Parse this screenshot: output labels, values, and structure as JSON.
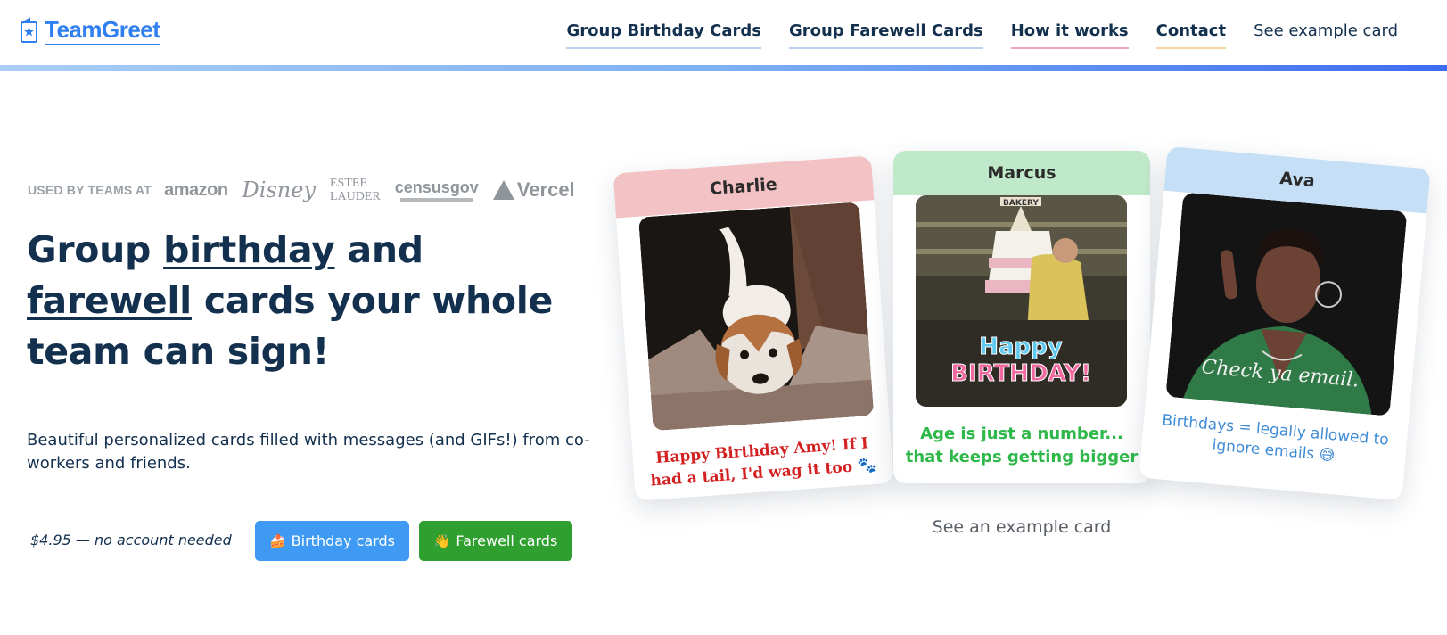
{
  "header": {
    "logo_text": "TeamGreet",
    "nav": [
      {
        "label": "Group Birthday Cards"
      },
      {
        "label": "Group Farewell Cards"
      },
      {
        "label": "How it works"
      },
      {
        "label": "Contact"
      },
      {
        "label": "See example card"
      }
    ]
  },
  "hero": {
    "used_by_label": "USED BY TEAMS AT",
    "brands": [
      "amazon",
      "Disney",
      "ESTEE",
      "LAUDER",
      "censusgov",
      "Vercel"
    ],
    "headline_part1": "Group ",
    "headline_link1": "birthday",
    "headline_part2": " and ",
    "headline_link2": "farewell",
    "headline_part3": " cards your whole team can sign!",
    "subtext": "Beautiful personalized cards filled with messages (and GIFs!) from co-workers and friends.",
    "price_note": "$4.95 — no account needed",
    "buttons": {
      "birthday": {
        "emoji": "🍰",
        "label": "Birthday cards"
      },
      "farewell": {
        "emoji": "👋",
        "label": "Farewell cards"
      }
    }
  },
  "cards": [
    {
      "name": "Charlie",
      "caption": "Happy Birthday Amy! If I had a tail, I'd wag it too 🐾",
      "header_color": "#f3c2c4",
      "caption_color": "#d32020"
    },
    {
      "name": "Marcus",
      "caption": "Age is just a number... that keeps getting bigger",
      "header_color": "#bfe9c9",
      "caption_color": "#2fb84a",
      "gif_text_line1": "Happy",
      "gif_text_line2": "BIRTHDAY!",
      "gif_sign": "BAKERY"
    },
    {
      "name": "Ava",
      "caption": "Birthdays = legally allowed to ignore emails 😅",
      "header_color": "#c5dff6",
      "caption_color": "#3f8bd6",
      "gif_text": "Check ya email."
    }
  ],
  "see_example": "See an example card",
  "colors": {
    "brand_blue": "#2f7ff0",
    "navy_text": "#13304e",
    "birthday_button": "#3f9af3",
    "farewell_button": "#2f9f2f"
  }
}
